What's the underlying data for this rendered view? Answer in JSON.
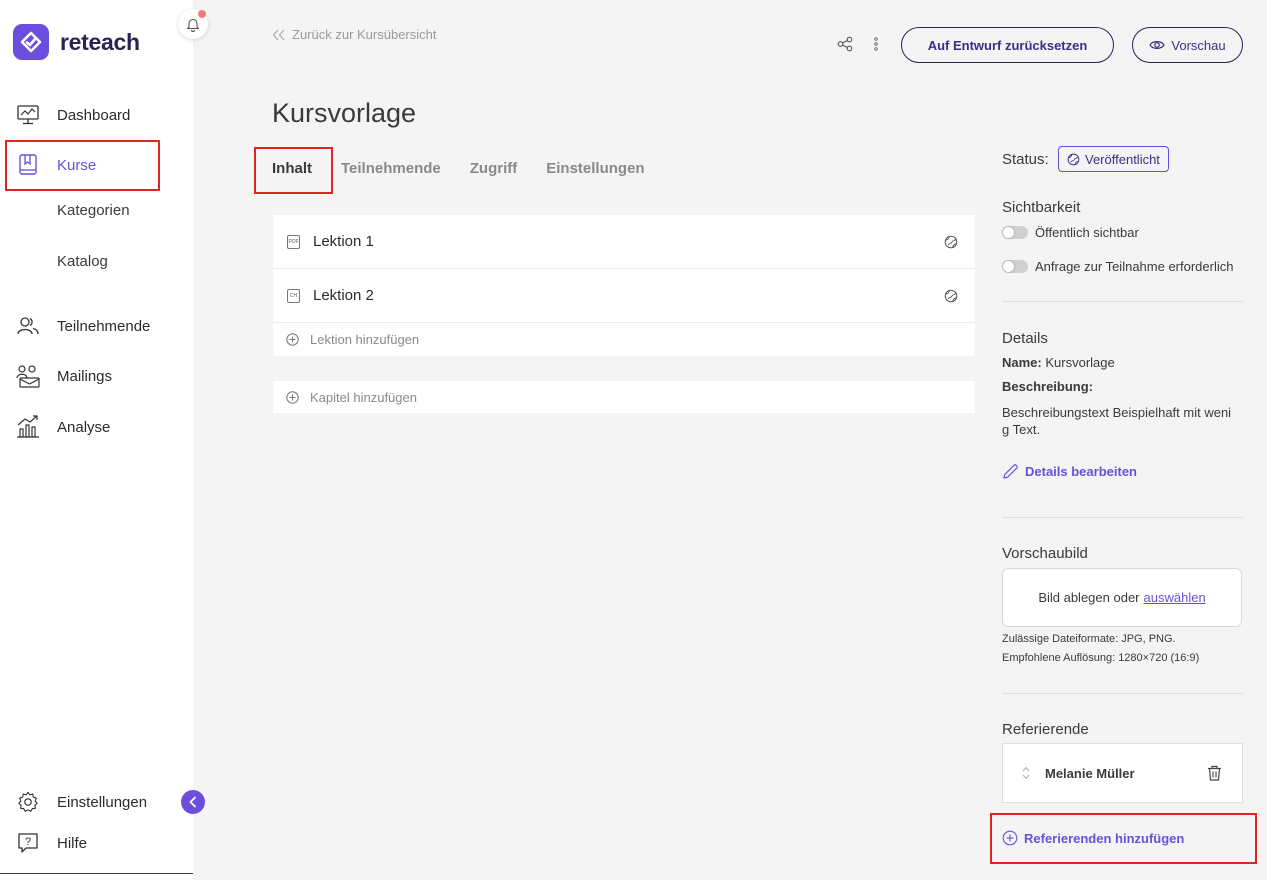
{
  "app": {
    "name": "reteach"
  },
  "sidebar": {
    "items": [
      {
        "label": "Dashboard",
        "icon": "dashboard-icon"
      },
      {
        "label": "Kurse",
        "icon": "book-icon",
        "active": true
      },
      {
        "label": "Kategorien"
      },
      {
        "label": "Katalog"
      },
      {
        "label": "Teilnehmende",
        "icon": "users-icon"
      },
      {
        "label": "Mailings",
        "icon": "mailings-icon"
      },
      {
        "label": "Analyse",
        "icon": "analytics-icon"
      }
    ],
    "bottom": [
      {
        "label": "Einstellungen",
        "icon": "gear-icon"
      },
      {
        "label": "Hilfe",
        "icon": "help-icon"
      }
    ]
  },
  "header": {
    "back_label": "Zurück zur Kursübersicht",
    "reset_button": "Auf Entwurf zurücksetzen",
    "preview_button": "Vorschau"
  },
  "page": {
    "title": "Kursvorlage",
    "tabs": [
      {
        "label": "Inhalt",
        "active": true
      },
      {
        "label": "Teilnehmende"
      },
      {
        "label": "Zugriff"
      },
      {
        "label": "Einstellungen"
      }
    ]
  },
  "content": {
    "lessons": [
      {
        "label": "Lektion 1",
        "type": "PDF"
      },
      {
        "label": "Lektion 2",
        "type": "CH"
      }
    ],
    "add_lesson": "Lektion hinzufügen",
    "add_chapter": "Kapitel hinzufügen"
  },
  "panel": {
    "status_label": "Status:",
    "status_value": "Veröffentlicht",
    "visibility_title": "Sichtbarkeit",
    "toggle_public": "Öffentlich sichtbar",
    "toggle_request": "Anfrage zur Teilnahme erforderlich",
    "details_title": "Details",
    "name_label": "Name:",
    "name_value": "Kursvorlage",
    "description_label": "Beschreibung:",
    "description_line1": "Beschreibungstext Beispielhaft mit weni",
    "description_line2": "g Text.",
    "edit_details": "Details bearbeiten",
    "preview_image_title": "Vorschaubild",
    "dropzone_text": "Bild ablegen oder",
    "dropzone_link": "auswählen",
    "formats_note": "Zulässige Dateiformate: JPG, PNG.",
    "resolution_note": "Empfohlene Auflösung: 1280×720 (16:9)",
    "speakers_title": "Referierende",
    "speaker_name": "Melanie Müller",
    "add_speaker": "Referierenden hinzufügen"
  },
  "colors": {
    "accent": "#6b4fdc",
    "highlight": "#e02424"
  }
}
